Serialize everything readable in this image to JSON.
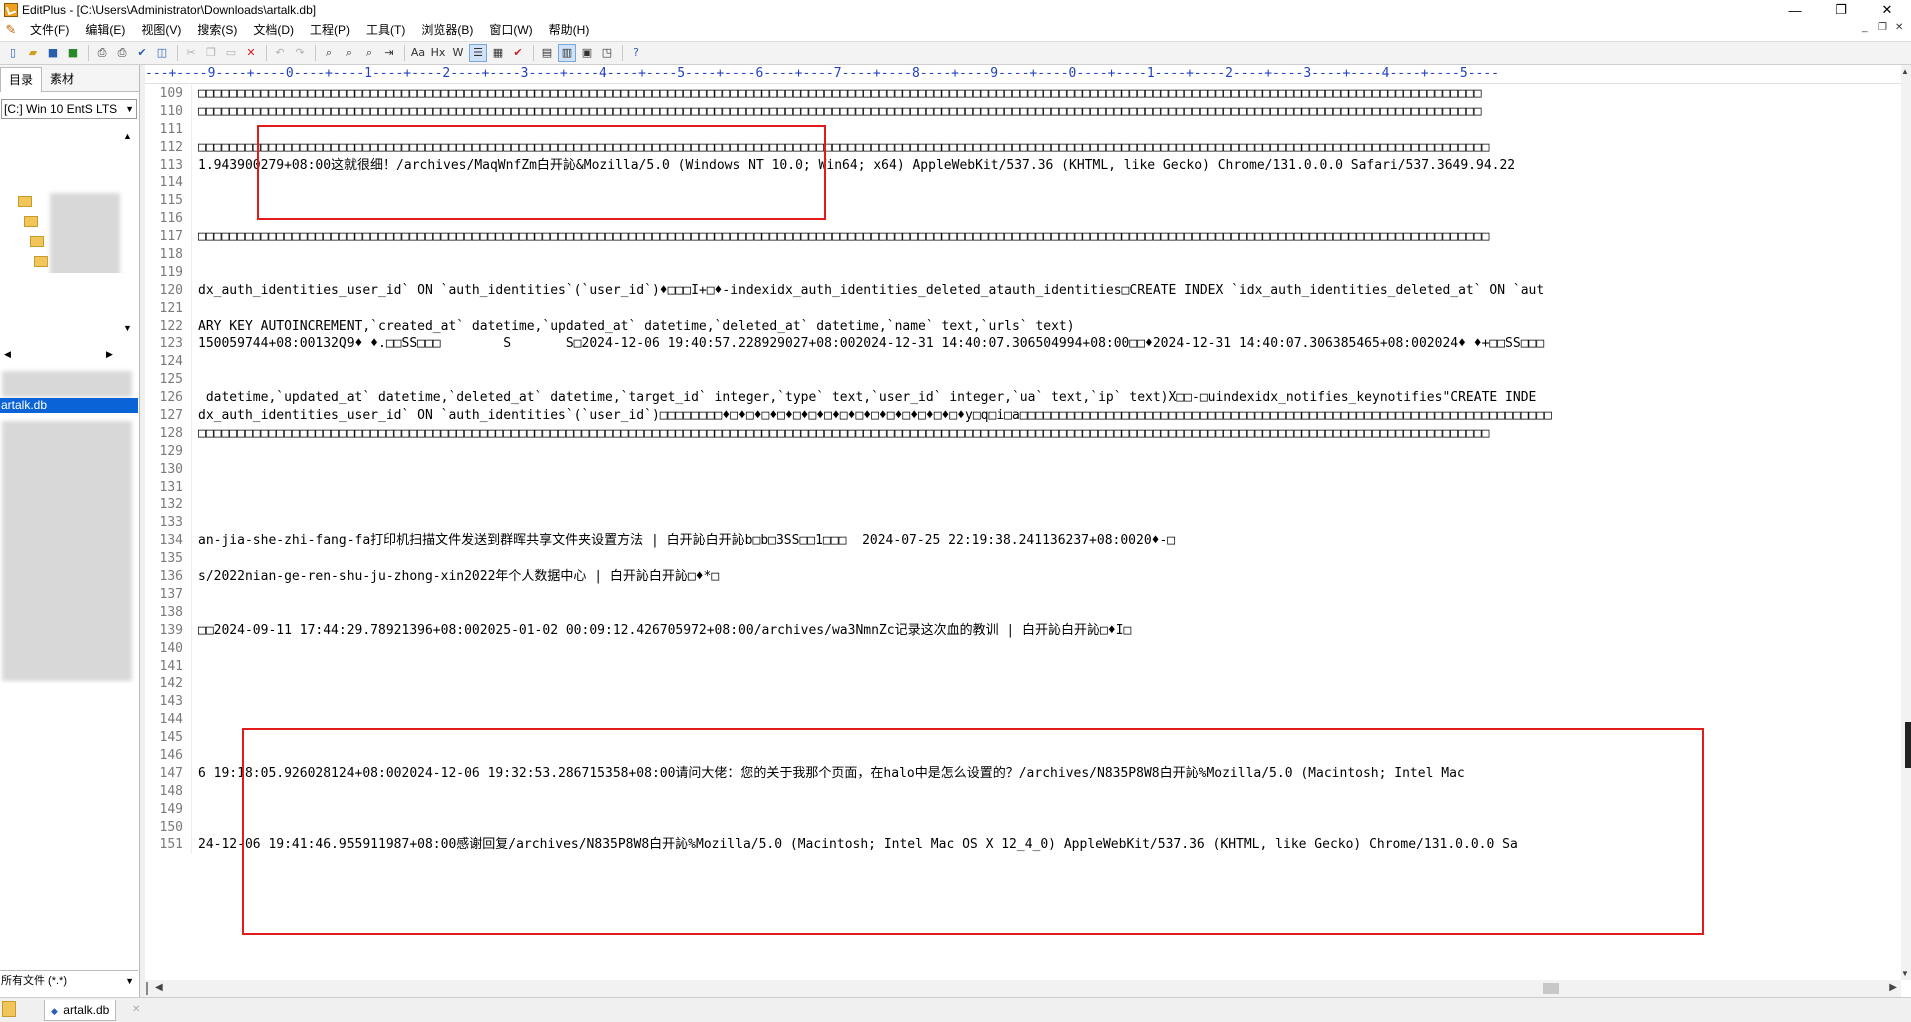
{
  "window": {
    "title": "EditPlus - [C:\\Users\\Administrator\\Downloads\\artalk.db]",
    "controls": {
      "minimize": "—",
      "restore": "❐",
      "close": "✕"
    }
  },
  "menu": {
    "items": [
      "文件(F)",
      "编辑(E)",
      "视图(V)",
      "搜索(S)",
      "文档(D)",
      "工程(P)",
      "工具(T)",
      "浏览器(B)",
      "窗口(W)",
      "帮助(H)"
    ]
  },
  "sidebar": {
    "tabs": [
      "目录",
      "素材"
    ],
    "drive": "[C:] Win 10 EntS LTS",
    "selected_file": "artalk.db",
    "filter": "所有文件 (*.*)"
  },
  "file_tab": {
    "label": "artalk.db"
  },
  "editor": {
    "ruler": "---+----9----+----0----+----1----+----2----+----3----+----4----+----5----+----6----+----7----+----8----+----9----+----0----+----1----+----2----+----3----+----4----+----5----",
    "lines": [
      {
        "n": "109",
        "t": "□□□□□□□□□□□□□□□□□□□□□□□□□□□□□□□□□□□□□□□□□□□□□□□□□□□□□□□□□□□□□□□□□□□□□□□□□□□□□□□□□□□□□□□□□□□□□□□□□□□□□□□□□□□□□□□□□□□□□□□□□□□□□□□□□□□□□□□□□□□□□□□□□□□□□□□□□□□□□□□□□□□□"
      },
      {
        "n": "110",
        "t": "□□□□□□□□□□□□□□□□□□□□□□□□□□□□□□□□□□□□□□□□□□□□□□□□□□□□□□□□□□□□□□□□□□□□□□□□□□□□□□□□□□□□□□□□□□□□□□□□□□□□□□□□□□□□□□□□□□□□□□□□□□□□□□□□□□□□□□□□□□□□□□□□□□□□□□□□□□□□□□□□□□□□"
      },
      {
        "n": "111",
        "t": ""
      },
      {
        "n": "112",
        "t": "□□□□□□□□□□□□□□□□□□□□□□□□□□□□□□□□□□□□□□□□□□□□□□□□□□□□□□□□□□□□□□□□□□□□□□□□□□□□□□□□□□□□□□□□□□□□□□□□□□□□□□□□□□□□□□□□□□□□□□□□□□□□□□□□□□□□□□□□□□□□□□□□□□□□□□□□□□□□□□□□□□□□□"
      },
      {
        "n": "113",
        "t": "1.943900279+08:00这就很细！/archives/MaqWnfZm白开訫&Mozilla/5.0 (Windows NT 10.0; Win64; x64) AppleWebKit/537.36 (KHTML, like Gecko) Chrome/131.0.0.0 Safari/537.3649.94.22"
      },
      {
        "n": "114",
        "t": ""
      },
      {
        "n": "115",
        "t": ""
      },
      {
        "n": "116",
        "t": ""
      },
      {
        "n": "117",
        "t": "□□□□□□□□□□□□□□□□□□□□□□□□□□□□□□□□□□□□□□□□□□□□□□□□□□□□□□□□□□□□□□□□□□□□□□□□□□□□□□□□□□□□□□□□□□□□□□□□□□□□□□□□□□□□□□□□□□□□□□□□□□□□□□□□□□□□□□□□□□□□□□□□□□□□□□□□□□□□□□□□□□□□□"
      },
      {
        "n": "118",
        "t": ""
      },
      {
        "n": "119",
        "t": ""
      },
      {
        "n": "120",
        "t": "dx_auth_identities_user_id` ON `auth_identities`(`user_id`)♦□□□I+□♦-indexidx_auth_identities_deleted_atauth_identities□CREATE INDEX `idx_auth_identities_deleted_at` ON `aut"
      },
      {
        "n": "121",
        "t": ""
      },
      {
        "n": "122",
        "t": "ARY KEY AUTOINCREMENT,`created_at` datetime,`updated_at` datetime,`deleted_at` datetime,`name` text,`urls` text)"
      },
      {
        "n": "123",
        "t": "150059744+08:00132Q9♦ ♦.□□SS□□□        S       S□2024-12-06 19:40:57.228929027+08:002024-12-31 14:40:07.306504994+08:00□□♦2024-12-31 14:40:07.306385465+08:002024♦ ♦+□□SS□□□"
      },
      {
        "n": "124",
        "t": ""
      },
      {
        "n": "125",
        "t": ""
      },
      {
        "n": "126",
        "t": " datetime,`updated_at` datetime,`deleted_at` datetime,`target_id` integer,`type` text,`user_id` integer,`ua` text,`ip` text)X□□-□uindexidx_notifies_keynotifies\"CREATE INDE"
      },
      {
        "n": "127",
        "t": "dx_auth_identities_user_id` ON `auth_identities`(`user_id`)□□□□□□□□♦□♦□♦□♦□♦□♦□♦□♦□♦□♦□♦□♦□♦□♦□♦□♦y□q□i□a□□□□□□□□□□□□□□□□□□□□□□□□□□□□□□□□□□□□□□□□□□□□□□□□□□□□□□□□□□□□□□□□□□□□"
      },
      {
        "n": "128",
        "t": "□□□□□□□□□□□□□□□□□□□□□□□□□□□□□□□□□□□□□□□□□□□□□□□□□□□□□□□□□□□□□□□□□□□□□□□□□□□□□□□□□□□□□□□□□□□□□□□□□□□□□□□□□□□□□□□□□□□□□□□□□□□□□□□□□□□□□□□□□□□□□□□□□□□□□□□□□□□□□□□□□□□□□"
      },
      {
        "n": "129",
        "t": ""
      },
      {
        "n": "130",
        "t": ""
      },
      {
        "n": "131",
        "t": ""
      },
      {
        "n": "132",
        "t": ""
      },
      {
        "n": "133",
        "t": ""
      },
      {
        "n": "134",
        "t": "an-jia-she-zhi-fang-fa打印机扫描文件发送到群晖共享文件夹设置方法 | 白开訫白开訫b□b□3SS□□1□□□  2024-07-25 22:19:38.241136237+08:0020♦-□"
      },
      {
        "n": "135",
        "t": ""
      },
      {
        "n": "136",
        "t": "s/2022nian-ge-ren-shu-ju-zhong-xin2022年个人数据中心 | 白开訫白开訫□♦*□"
      },
      {
        "n": "137",
        "t": ""
      },
      {
        "n": "138",
        "t": ""
      },
      {
        "n": "139",
        "t": "□□2024-09-11 17:44:29.78921396+08:002025-01-02 00:09:12.426705972+08:00/archives/wa3NmnZc记录这次血的教训 | 白开訫白开訫□♦I□"
      },
      {
        "n": "140",
        "t": ""
      },
      {
        "n": "141",
        "t": ""
      },
      {
        "n": "142",
        "t": ""
      },
      {
        "n": "143",
        "t": ""
      },
      {
        "n": "144",
        "t": ""
      },
      {
        "n": "145",
        "t": ""
      },
      {
        "n": "146",
        "t": ""
      },
      {
        "n": "147",
        "t": "6 19:18:05.926028124+08:002024-12-06 19:32:53.286715358+08:00请问大佬：您的关于我那个页面，在halo中是怎么设置的？/archives/N835P8W8白开訫%Mozilla/5.0 (Macintosh; Intel Mac"
      },
      {
        "n": "148",
        "t": ""
      },
      {
        "n": "149",
        "t": ""
      },
      {
        "n": "150",
        "t": ""
      },
      {
        "n": "151",
        "t": "24-12-06 19:41:46.955911987+08:00感谢回复/archives/N835P8W8白开訫%Mozilla/5.0 (Macintosh; Intel Mac OS X 12_4_0) AppleWebKit/537.36 (KHTML, like Gecko) Chrome/131.0.0.0 Sa"
      }
    ]
  },
  "colors": {
    "annotation_box": "#e31b1b",
    "selection": "#0a64d8",
    "ruler": "#2040c0"
  }
}
